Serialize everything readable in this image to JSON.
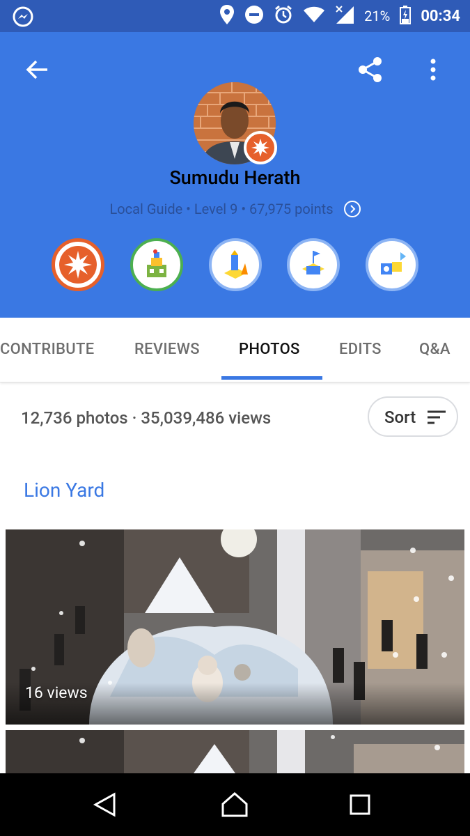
{
  "status_bar": {
    "battery_pct": "21%",
    "time": "00:34",
    "icons": [
      "messenger-icon",
      "location-icon",
      "do-not-disturb-icon",
      "alarm-icon",
      "wifi-icon",
      "signal-icon",
      "battery-charging-icon"
    ]
  },
  "header": {
    "name": "Sumudu Herath",
    "subtitle": "Local Guide • Level 9 • 67,975 points",
    "accent": "#3a78e3",
    "badges": [
      "local-guide-level-badge",
      "places-badge",
      "reviews-badge",
      "edits-badge",
      "qa-badge"
    ]
  },
  "tabs": [
    {
      "label": "CONTRIBUTE"
    },
    {
      "label": "REVIEWS"
    },
    {
      "label": "PHOTOS",
      "active": true
    },
    {
      "label": "EDITS"
    },
    {
      "label": "Q&A"
    }
  ],
  "stats": {
    "summary": "12,736 photos · 35,039,486 views",
    "sort_label": "Sort"
  },
  "place": {
    "name": "Lion Yard"
  },
  "photos": [
    {
      "views": "16 views"
    },
    {
      "views": ""
    }
  ]
}
